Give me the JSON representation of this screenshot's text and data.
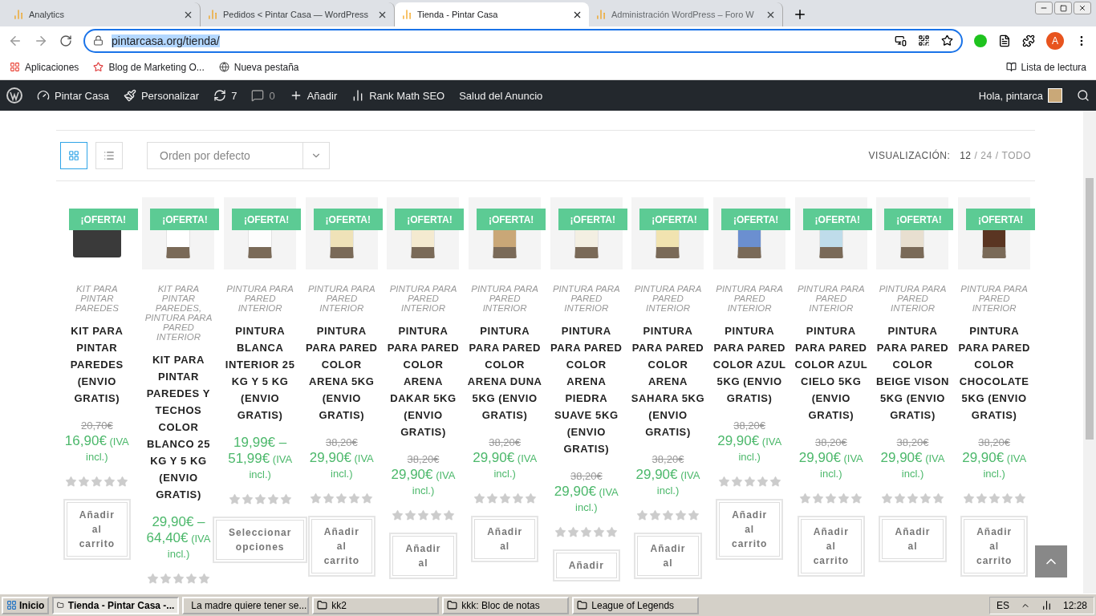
{
  "browser": {
    "tabs": [
      {
        "title": "Analytics",
        "selected": false
      },
      {
        "title": "Pedidos < Pintar Casa — WordPress",
        "selected": false
      },
      {
        "title": "Tienda - Pintar Casa",
        "selected": true
      },
      {
        "title": "Administración WordPress – Foro W",
        "selected": false
      }
    ],
    "url": "pintarcasa.org/tienda/",
    "bookmarks": [
      "Aplicaciones",
      "Blog de Marketing O...",
      "Nueva pestaña"
    ],
    "reading_list": "Lista de lectura",
    "profile_initial": "A"
  },
  "admin_bar": {
    "site": "Pintar Casa",
    "customize": "Personalizar",
    "updates": "7",
    "comments": "0",
    "new": "Añadir",
    "seo": "Rank Math SEO",
    "ads": "Salud del Anuncio",
    "greeting": "Hola, pintarca"
  },
  "toolbar": {
    "views": [
      {
        "kind": "grid",
        "selected": true
      },
      {
        "kind": "list",
        "selected": false
      }
    ],
    "sort": "Orden por defecto",
    "per_page_label": "VISUALIZACIÓN:",
    "separator": "/",
    "per_page": [
      {
        "label": "12",
        "selected": true
      },
      {
        "label": "24",
        "selected": false
      },
      {
        "label": "TODO",
        "selected": false
      }
    ]
  },
  "products": [
    {
      "kind": "kit",
      "color": "#3a3a3a",
      "badge": "¡OFERTA!",
      "category": "KIT PARA PINTAR PAREDES",
      "title": "KIT PARA PINTAR PAREDES (ENVIO GRATIS)",
      "old_price": "20,70€",
      "price": "16,90€",
      "tax": "(IVA incl.)",
      "stars": 0,
      "button": "Añadir al carrito"
    },
    {
      "kind": "paint",
      "color": "#ffffff",
      "badge": "¡OFERTA!",
      "category": "KIT PARA PINTAR PAREDES, PINTURA PARA PARED INTERIOR",
      "title": "KIT PARA PINTAR PAREDES Y TECHOS COLOR BLANCO 25 KG Y 5 KG (ENVIO GRATIS)",
      "price": "29,90€ – 64,40€",
      "tax": "(IVA incl.)",
      "stars": 0
    },
    {
      "kind": "paint",
      "color": "#fdfdfd",
      "badge": "¡OFERTA!",
      "category": "PINTURA PARA PARED INTERIOR",
      "title": "PINTURA BLANCA INTERIOR 25 KG Y 5 KG (ENVIO GRATIS)",
      "price": "19,99€ – 51,99€",
      "tax": "(IVA incl.)",
      "stars": 0,
      "button": "Seleccionar opciones"
    },
    {
      "kind": "paint",
      "color": "#efe2b8",
      "badge": "¡OFERTA!",
      "category": "PINTURA PARA PARED INTERIOR",
      "title": "PINTURA PARA PARED COLOR ARENA 5KG (ENVIO GRATIS)",
      "old_price": "38,20€",
      "price": "29,90€",
      "tax": "(IVA incl.)",
      "stars": 0,
      "button": "Añadir al carrito"
    },
    {
      "kind": "paint",
      "color": "#f4ead0",
      "badge": "¡OFERTA!",
      "category": "PINTURA PARA PARED INTERIOR",
      "title": "PINTURA PARA PARED COLOR ARENA DAKAR 5KG (ENVIO GRATIS)",
      "old_price": "38,20€",
      "price": "29,90€",
      "tax": "(IVA incl.)",
      "stars": 0,
      "button": "Añadir al"
    },
    {
      "kind": "paint",
      "color": "#c9a777",
      "badge": "¡OFERTA!",
      "category": "PINTURA PARA PARED INTERIOR",
      "title": "PINTURA PARA PARED COLOR ARENA DUNA 5KG (ENVIO GRATIS)",
      "old_price": "38,20€",
      "price": "29,90€",
      "tax": "(IVA incl.)",
      "stars": 0,
      "button": "Añadir al"
    },
    {
      "kind": "paint",
      "color": "#f3efe2",
      "badge": "¡OFERTA!",
      "category": "PINTURA PARA PARED INTERIOR",
      "title": "PINTURA PARA PARED COLOR ARENA PIEDRA SUAVE 5KG (ENVIO GRATIS)",
      "old_price": "38,20€",
      "price": "29,90€",
      "tax": "(IVA incl.)",
      "stars": 0,
      "button": "Añadir"
    },
    {
      "kind": "paint",
      "color": "#f1e3b0",
      "badge": "¡OFERTA!",
      "category": "PINTURA PARA PARED INTERIOR",
      "title": "PINTURA PARA PARED COLOR ARENA SAHARA 5KG (ENVIO GRATIS)",
      "old_price": "38,20€",
      "price": "29,90€",
      "tax": "(IVA incl.)",
      "stars": 0,
      "button": "Añadir al"
    },
    {
      "kind": "paint",
      "color": "#6b8fd0",
      "badge": "¡OFERTA!",
      "category": "PINTURA PARA PARED INTERIOR",
      "title": "PINTURA PARA PARED COLOR AZUL 5KG (ENVIO GRATIS)",
      "old_price": "38,20€",
      "price": "29,90€",
      "tax": "(IVA incl.)",
      "stars": 0,
      "button": "Añadir al carrito"
    },
    {
      "kind": "paint",
      "color": "#bfdcea",
      "badge": "¡OFERTA!",
      "category": "PINTURA PARA PARED INTERIOR",
      "title": "PINTURA PARA PARED COLOR AZUL CIELO 5KG (ENVIO GRATIS)",
      "old_price": "38,20€",
      "price": "29,90€",
      "tax": "(IVA incl.)",
      "stars": 0,
      "button": "Añadir al carrito"
    },
    {
      "kind": "paint",
      "color": "#e8dfd0",
      "badge": "¡OFERTA!",
      "category": "PINTURA PARA PARED INTERIOR",
      "title": "PINTURA PARA PARED COLOR BEIGE VISON 5KG (ENVIO GRATIS)",
      "old_price": "38,20€",
      "price": "29,90€",
      "tax": "(IVA incl.)",
      "stars": 0,
      "button": "Añadir al"
    },
    {
      "kind": "paint",
      "color": "#5a3522",
      "badge": "¡OFERTA!",
      "category": "PINTURA PARA PARED INTERIOR",
      "title": "PINTURA PARA PARED COLOR CHOCOLATE 5KG (ENVIO GRATIS)",
      "old_price": "38,20€",
      "price": "29,90€",
      "tax": "(IVA incl.)",
      "stars": 0,
      "button": "Añadir al carrito"
    }
  ],
  "taskbar": {
    "start": "Inicio",
    "tasks": [
      {
        "title": "Tienda - Pintar Casa -...",
        "selected": true
      },
      {
        "title": "La madre quiere tener se...",
        "selected": false
      },
      {
        "title": "kk2",
        "selected": false
      },
      {
        "title": "kkk: Bloc de notas",
        "selected": false
      },
      {
        "title": "League of Legends",
        "selected": false
      }
    ],
    "language": "ES",
    "clock": "12:28"
  }
}
